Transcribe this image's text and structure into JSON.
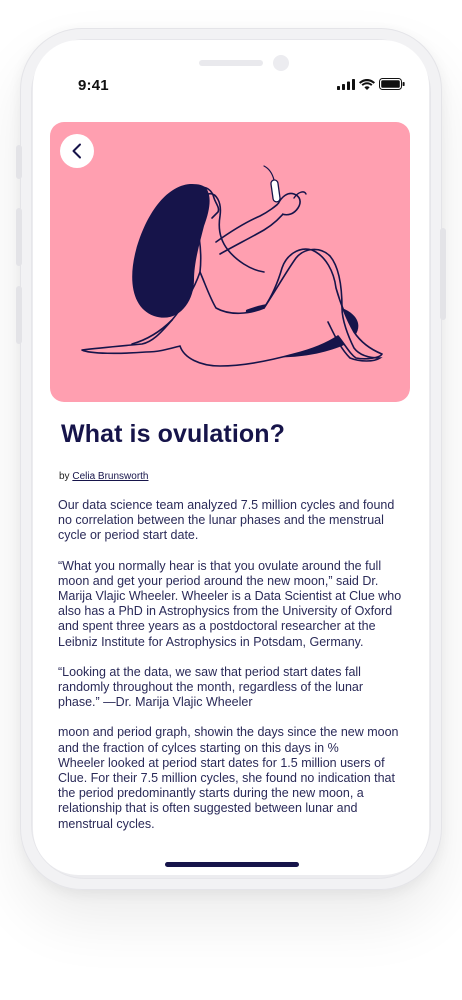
{
  "status_bar": {
    "time": "9:41",
    "icons": [
      "signal-icon",
      "wifi-icon",
      "battery-icon"
    ]
  },
  "hero": {
    "background_color": "#ff9fb0",
    "illustration": "woman-holding-tampon-illustration",
    "back_icon": "chevron-left-icon"
  },
  "article": {
    "title": "What is ovulation?",
    "byline_prefix": "by ",
    "author": "Celia Brunsworth",
    "paragraphs": [
      "Our data science team analyzed 7.5 million cycles and found no correlation between the lunar phases and the menstrual cycle or period start date.",
      "“What you normally hear is that you ovulate around the full moon and get your period around the new moon,” said Dr. Marija Vlajic Wheeler. Wheeler is a Data Scientist at Clue who also has a PhD in Astrophysics from the University of Oxford and spent three years as a postdoctoral researcher at the Leibniz Institute for Astrophysics in Potsdam, Germany.",
      "“Looking at the data, we saw that period start dates fall randomly throughout the month, regardless of the lunar phase.” —Dr. Marija Vlajic Wheeler",
      "moon and period graph, showin the days since the new moon and the fraction of cylces starting on this days in %",
      "Wheeler looked at period start dates for 1.5 million users of Clue. For their 7.5 million cycles, she found no indication that the period predominantly starts during the new moon, a relationship that is often suggested between lunar and menstrual cycles."
    ]
  },
  "colors": {
    "title": "#16144a",
    "body_text": "#2a2a58",
    "hero_pink": "#ff9fb0",
    "illustration_ink": "#16144a"
  }
}
